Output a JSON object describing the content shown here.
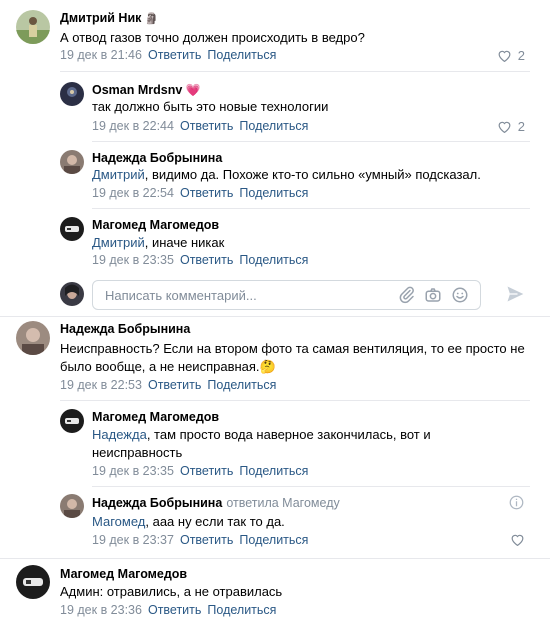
{
  "comments": [
    {
      "author": "Дмитрий Ник",
      "author_badge": "🗿",
      "text": "А отвод газов точно должен происходить в ведро?",
      "date": "19 дек в 21:46",
      "reply_label": "Ответить",
      "share_label": "Поделиться",
      "likes": "2"
    },
    {
      "author": "Osman Mrdsnv",
      "author_badge": "💗",
      "text": "так должно быть это новые технологии",
      "date": "19 дек в 22:44",
      "reply_label": "Ответить",
      "share_label": "Поделиться",
      "likes": "2"
    },
    {
      "author": "Надежда Бобрынина",
      "ref": "Дмитрий",
      "text": ", видимо да. Похоже кто-то сильно «умный» подсказал.",
      "date": "19 дек в 22:54",
      "reply_label": "Ответить",
      "share_label": "Поделиться"
    },
    {
      "author": "Магомед Магомедов",
      "ref": "Дмитрий",
      "text": ", иначе никак",
      "date": "19 дек в 23:35",
      "reply_label": "Ответить",
      "share_label": "Поделиться"
    },
    {
      "author": "Надежда Бобрынина",
      "text_line1": "Неисправность? Если на втором фото та самая вентиляция, то ее просто не",
      "text_line2": "было вообще, а не неисправная.",
      "emoji": "🤔",
      "date": "19 дек в 22:53",
      "reply_label": "Ответить",
      "share_label": "Поделиться"
    },
    {
      "author": "Магомед Магомедов",
      "ref": "Надежда",
      "text_line1": ", там просто вода наверное закончилась, вот и",
      "text_line2": "неисправность",
      "date": "19 дек в 23:35",
      "reply_label": "Ответить",
      "share_label": "Поделиться"
    },
    {
      "author": "Надежда Бобрынина",
      "replied_to": "ответила Магомеду",
      "ref": "Магомед",
      "text": ", ааа ну если так то да.",
      "date": "19 дек в 23:37",
      "reply_label": "Ответить",
      "share_label": "Поделиться"
    },
    {
      "author": "Магомед Магомедов",
      "text": "Админ: отравились, а не отравилась",
      "date": "19 дек в 23:36",
      "reply_label": "Ответить",
      "share_label": "Поделиться"
    }
  ],
  "composer": {
    "placeholder": "Написать комментарий..."
  },
  "colors": {
    "link": "#2a5885",
    "meta": "#818c99",
    "separator": "#e7e8ec"
  }
}
